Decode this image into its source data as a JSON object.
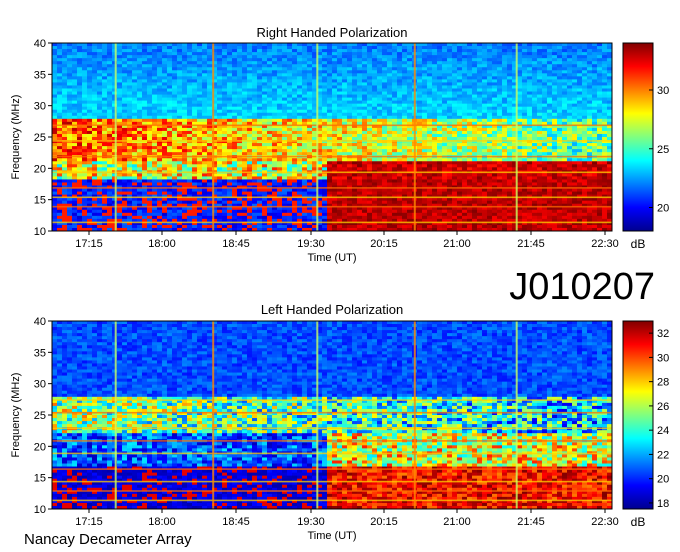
{
  "figure": {
    "observation_id": "J010207",
    "instrument": "Nancay Decameter Array"
  },
  "chart_data": [
    {
      "type": "heatmap",
      "title": "Right Handed Polarization",
      "xlabel": "Time (UT)",
      "ylabel": "Frequency (MHz)",
      "x_ticks": [
        "17:15",
        "18:00",
        "18:45",
        "19:30",
        "20:15",
        "21:00",
        "21:45",
        "22:30"
      ],
      "y_ticks": [
        10,
        15,
        20,
        25,
        30,
        35,
        40
      ],
      "ylim": [
        10,
        40
      ],
      "colorbar": {
        "label": "dB",
        "ticks": [
          20,
          25,
          30
        ],
        "range": [
          18,
          34
        ]
      }
    },
    {
      "type": "heatmap",
      "title": "Left Handed Polarization",
      "xlabel": "Time (UT)",
      "ylabel": "Frequency (MHz)",
      "x_ticks": [
        "17:15",
        "18:00",
        "18:45",
        "19:30",
        "20:15",
        "21:00",
        "21:45",
        "22:30"
      ],
      "y_ticks": [
        10,
        15,
        20,
        25,
        30,
        35,
        40
      ],
      "ylim": [
        10,
        40
      ],
      "colorbar": {
        "label": "dB",
        "ticks": [
          18,
          20,
          22,
          24,
          26,
          28,
          30,
          32
        ],
        "range": [
          17.5,
          33
        ]
      }
    }
  ]
}
